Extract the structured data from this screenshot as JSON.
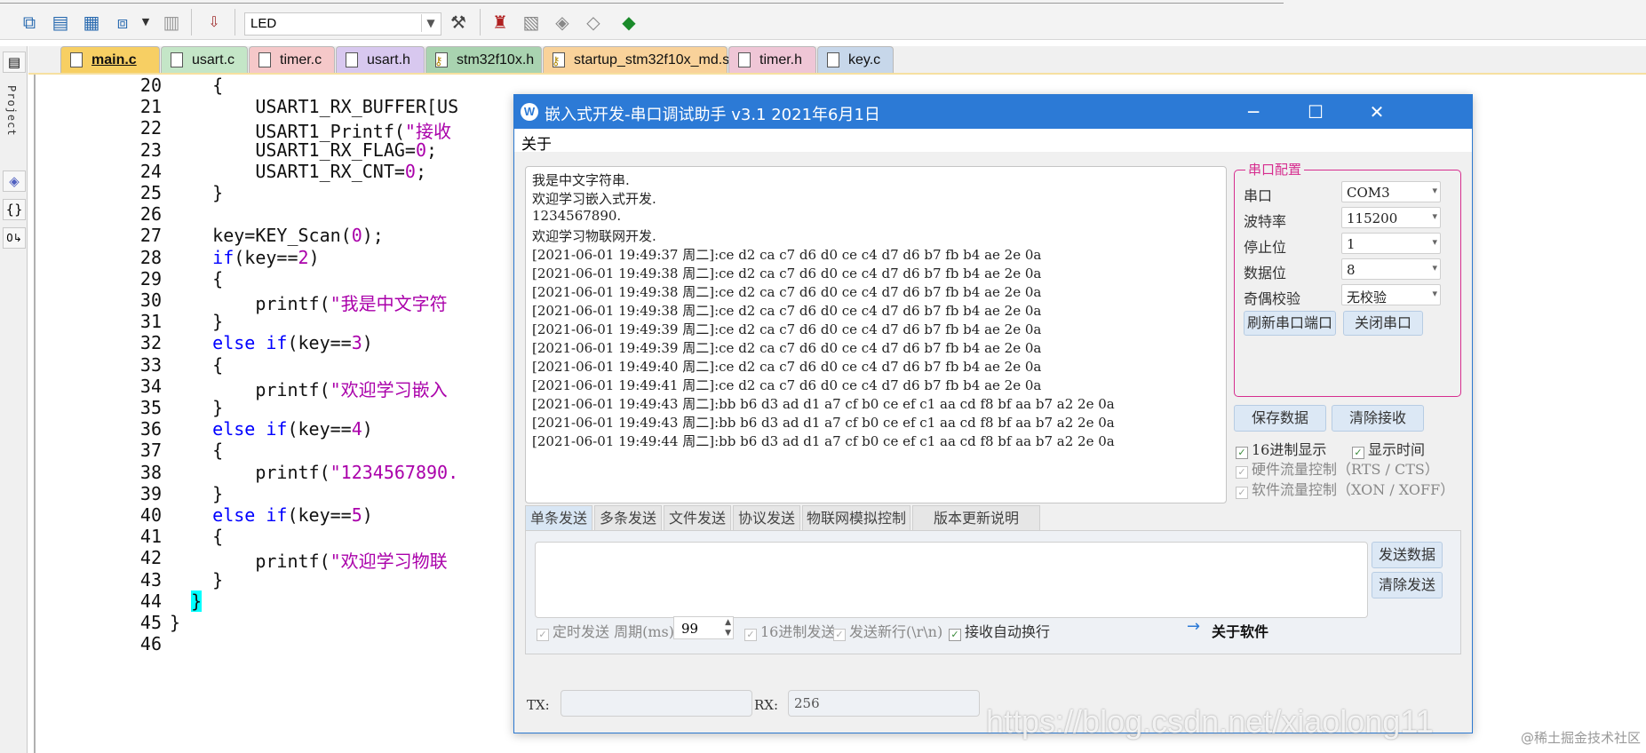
{
  "toolbar": {
    "target": "LED",
    "icons": [
      "translate-icon",
      "build-icon",
      "rebuild-icon",
      "batch-build-icon",
      "stop-build-icon",
      "load-icon",
      "target-options-icon",
      "manage-components-icon",
      "pack-installer-icon",
      "run-time-env-icon",
      "select-packs-icon"
    ]
  },
  "left_dock": {
    "label": "Project"
  },
  "tabs": [
    {
      "label": "main.c",
      "color": "#f7cf63",
      "active": true
    },
    {
      "label": "usart.c",
      "color": "#c4e6c7"
    },
    {
      "label": "timer.c",
      "color": "#f5c8c9"
    },
    {
      "label": "usart.h",
      "color": "#d8c8ef"
    },
    {
      "label": "stm32f10x.h",
      "color": "#a9d3b0"
    },
    {
      "label": "startup_stm32f10x_md.s",
      "color": "#f9d29a"
    },
    {
      "label": "timer.h",
      "color": "#efc6d6"
    },
    {
      "label": "key.c",
      "color": "#c7d7ea"
    }
  ],
  "editor": {
    "lines": [
      {
        "n": "20",
        "html": "    {"
      },
      {
        "n": "21",
        "html": "        USART1_RX_BUFFER[US"
      },
      {
        "n": "22",
        "html": "        USART1_Printf(<span class='str'>\"接收</span>"
      },
      {
        "n": "23",
        "html": "        USART1_RX_FLAG=<span class='num'>0</span>;"
      },
      {
        "n": "24",
        "html": "        USART1_RX_CNT=<span class='num'>0</span>;"
      },
      {
        "n": "25",
        "html": "    }"
      },
      {
        "n": "26",
        "html": ""
      },
      {
        "n": "27",
        "html": "    key=KEY_Scan(<span class='num'>0</span>);"
      },
      {
        "n": "28",
        "html": "    <span class='kw'>if</span>(key==<span class='num'>2</span>)"
      },
      {
        "n": "29",
        "html": "    {"
      },
      {
        "n": "30",
        "html": "        printf(<span class='str'>\"我是中文字符</span>"
      },
      {
        "n": "31",
        "html": "    }"
      },
      {
        "n": "32",
        "html": "    <span class='kw'>else if</span>(key==<span class='num'>3</span>)"
      },
      {
        "n": "33",
        "html": "    {"
      },
      {
        "n": "34",
        "html": "        printf(<span class='str'>\"欢迎学习嵌入</span>"
      },
      {
        "n": "35",
        "html": "    }"
      },
      {
        "n": "36",
        "html": "    <span class='kw'>else if</span>(key==<span class='num'>4</span>)"
      },
      {
        "n": "37",
        "html": "    {"
      },
      {
        "n": "38",
        "html": "        printf(<span class='str'>\"1234567890.</span>"
      },
      {
        "n": "39",
        "html": "    }"
      },
      {
        "n": "40",
        "html": "    <span class='kw'>else if</span>(key==<span class='num'>5</span>)"
      },
      {
        "n": "41",
        "html": "    {"
      },
      {
        "n": "42",
        "html": "        printf(<span class='str'>\"欢迎学习物联</span>"
      },
      {
        "n": "43",
        "html": "    }"
      },
      {
        "n": "44",
        "html": "  <span class='hl'>}</span>"
      },
      {
        "n": "45",
        "html": "}"
      },
      {
        "n": "46",
        "html": ""
      }
    ]
  },
  "dialog": {
    "title": "嵌入式开发-串口调试助手 v3.1 2021年6月1日",
    "menu_about": "关于",
    "receive_lines": [
      "我是中文字符串.",
      "欢迎学习嵌入式开发.",
      "1234567890.",
      "欢迎学习物联网开发.",
      "[2021-06-01 19:49:37 周二]:ce d2 ca c7 d6 d0 ce c4 d7 d6 b7 fb b4 ae 2e 0a",
      "[2021-06-01 19:49:38 周二]:ce d2 ca c7 d6 d0 ce c4 d7 d6 b7 fb b4 ae 2e 0a",
      "[2021-06-01 19:49:38 周二]:ce d2 ca c7 d6 d0 ce c4 d7 d6 b7 fb b4 ae 2e 0a",
      "[2021-06-01 19:49:38 周二]:ce d2 ca c7 d6 d0 ce c4 d7 d6 b7 fb b4 ae 2e 0a",
      "[2021-06-01 19:49:39 周二]:ce d2 ca c7 d6 d0 ce c4 d7 d6 b7 fb b4 ae 2e 0a",
      "[2021-06-01 19:49:39 周二]:ce d2 ca c7 d6 d0 ce c4 d7 d6 b7 fb b4 ae 2e 0a",
      "[2021-06-01 19:49:40 周二]:ce d2 ca c7 d6 d0 ce c4 d7 d6 b7 fb b4 ae 2e 0a",
      "[2021-06-01 19:49:41 周二]:ce d2 ca c7 d6 d0 ce c4 d7 d6 b7 fb b4 ae 2e 0a",
      "[2021-06-01 19:49:43 周二]:bb b6 d3 ad d1 a7 cf b0 ce ef c1 aa cd f8 bf aa b7 a2 2e 0a",
      "[2021-06-01 19:49:43 周二]:bb b6 d3 ad d1 a7 cf b0 ce ef c1 aa cd f8 bf aa b7 a2 2e 0a",
      "[2021-06-01 19:49:44 周二]:bb b6 d3 ad d1 a7 cf b0 ce ef c1 aa cd f8 bf aa b7 a2 2e 0a"
    ],
    "config": {
      "legend": "串口配置",
      "rows": [
        {
          "label": "串口",
          "value": "COM3"
        },
        {
          "label": "波特率",
          "value": "115200"
        },
        {
          "label": "停止位",
          "value": "1"
        },
        {
          "label": "数据位",
          "value": "8"
        },
        {
          "label": "奇偶校验",
          "value": "无校验"
        }
      ],
      "refresh_btn": "刷新串口端口",
      "close_btn": "关闭串口"
    },
    "save_btn": "保存数据",
    "clear_recv_btn": "清除接收",
    "hex_display": "16进制显示",
    "show_time": "显示时间",
    "hw_flow": "硬件流量控制（RTS / CTS）",
    "sw_flow": "软件流量控制（XON / XOFF）",
    "send_tabs": [
      "单条发送",
      "多条发送",
      "文件发送",
      "协议发送",
      "物联网模拟控制",
      "版本更新说明"
    ],
    "send_btn": "发送数据",
    "clear_send_btn": "清除发送",
    "timed_send": "定时发送 周期(ms):",
    "period": "99",
    "hex_send": "16进制发送",
    "send_newline": "发送新行(\\r\\n)",
    "auto_wrap": "接收自动换行",
    "about_software": "关于软件",
    "tx_label": "TX:",
    "tx_value": "",
    "rx_label": "RX:",
    "rx_value": "256"
  },
  "watermark": "https://blog.csdn.net/xiaolong11",
  "corner_watermark": "@稀土掘金技术社区"
}
